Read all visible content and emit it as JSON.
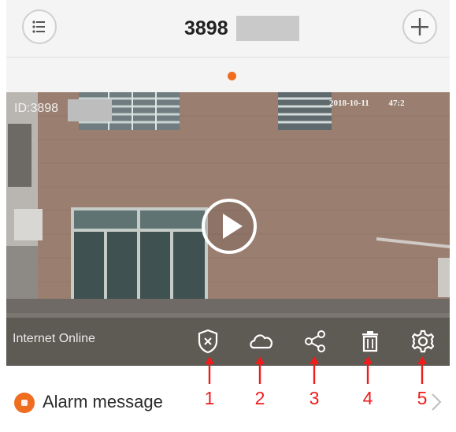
{
  "header": {
    "title": "3898",
    "menu_icon": "list-icon",
    "add_icon": "plus-icon"
  },
  "pager": {
    "active_color": "#ef6d1f"
  },
  "video": {
    "camera_id": "ID:3898",
    "timestamp_date": "2018-10-11",
    "timestamp_time": "47:2",
    "connection_status": "Internet Online",
    "controls": [
      {
        "name": "shield-icon",
        "marker": "1"
      },
      {
        "name": "cloud-icon",
        "marker": "2"
      },
      {
        "name": "share-icon",
        "marker": "3"
      },
      {
        "name": "trash-icon",
        "marker": "4"
      },
      {
        "name": "gear-icon",
        "marker": "5"
      }
    ]
  },
  "alarm": {
    "label": "Alarm message",
    "icon": "alarm-icon",
    "chevron": "chevron-right-icon"
  },
  "colors": {
    "accent": "#ef6d1f",
    "annotation": "#f01c1c"
  }
}
